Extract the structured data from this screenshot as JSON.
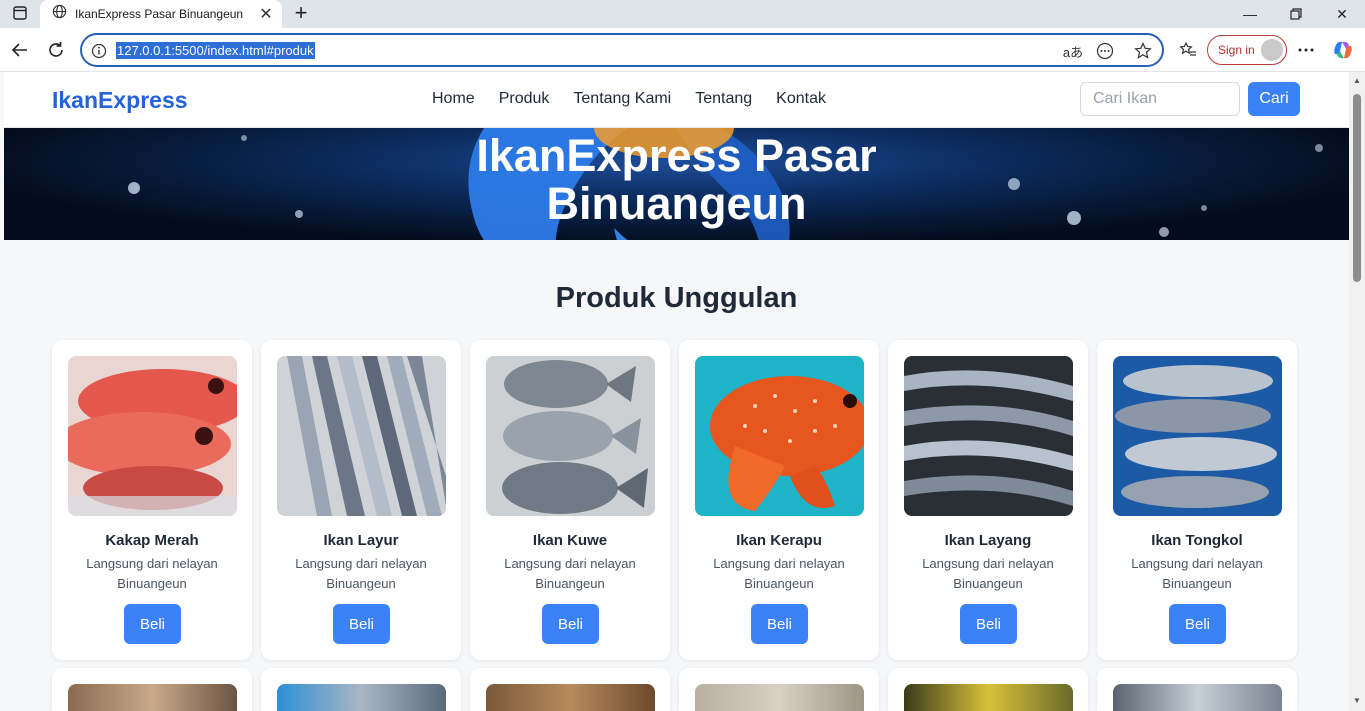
{
  "browser": {
    "tab_title": "IkanExpress Pasar Binuangeun",
    "url": "127.0.0.1:5500/index.html#produk",
    "sign_in_label": "Sign in",
    "read_aloud_glyph": "aあ"
  },
  "navbar": {
    "brand": "IkanExpress",
    "links": [
      "Home",
      "Produk",
      "Tentang Kami",
      "Tentang",
      "Kontak"
    ],
    "search_placeholder": "Cari Ikan",
    "search_button": "Cari"
  },
  "hero": {
    "title_line1": "IkanExpress Pasar",
    "title_line2": "Binuangeun"
  },
  "section": {
    "title": "Produk Unggulan"
  },
  "products": [
    {
      "name": "Kakap Merah",
      "description": "Langsung dari nelayan Binuangeun",
      "button": "Beli"
    },
    {
      "name": "Ikan Layur",
      "description": "Langsung dari nelayan Binuangeun",
      "button": "Beli"
    },
    {
      "name": "Ikan Kuwe",
      "description": "Langsung dari nelayan Binuangeun",
      "button": "Beli"
    },
    {
      "name": "Ikan Kerapu",
      "description": "Langsung dari nelayan Binuangeun",
      "button": "Beli"
    },
    {
      "name": "Ikan Layang",
      "description": "Langsung dari nelayan Binuangeun",
      "button": "Beli"
    },
    {
      "name": "Ikan Tongkol",
      "description": "Langsung dari nelayan Binuangeun",
      "button": "Beli"
    }
  ],
  "colors": {
    "accent": "#3b82f6",
    "brand": "#2563d6"
  }
}
